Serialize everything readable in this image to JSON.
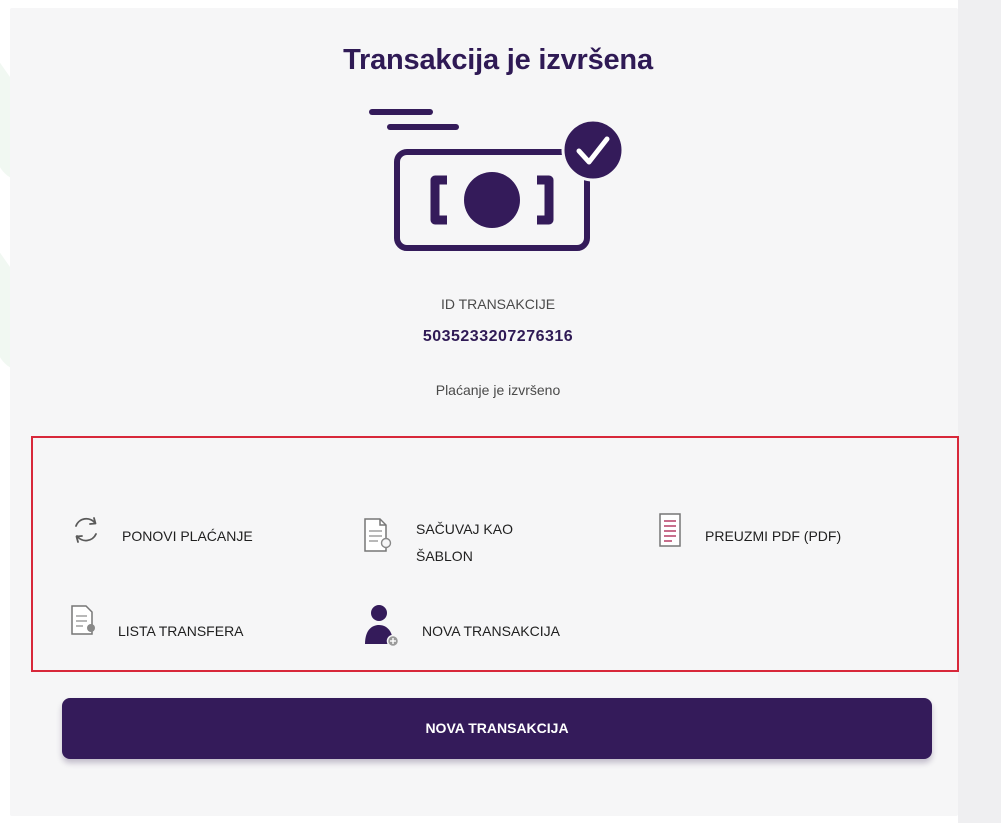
{
  "page": {
    "title": "Transakcija je izvršena",
    "transaction_id_label": "ID TRANSAKCIJE",
    "transaction_id": "5035233207276316",
    "status_text": "Plaćanje je izvršeno"
  },
  "actions": [
    {
      "label": "PONOVI PLAĆANJE",
      "icon": "refresh-icon"
    },
    {
      "label_line1": "SAČUVAJ KAO",
      "label_line2": "ŠABLON",
      "icon": "save-template-icon"
    },
    {
      "label": "PREUZMI PDF (PDF)",
      "icon": "pdf-document-icon"
    },
    {
      "label": "LISTA TRANSFERA",
      "icon": "transfer-list-icon"
    },
    {
      "label": "NOVA TRANSAKCIJA",
      "icon": "user-add-icon"
    }
  ],
  "primary_button": {
    "label": "NOVA TRANSAKCIJA"
  },
  "colors": {
    "brand": "#341b5a",
    "title": "#2f1a55",
    "highlight_border": "#d8283a",
    "card_background": "#f6f6f7"
  }
}
